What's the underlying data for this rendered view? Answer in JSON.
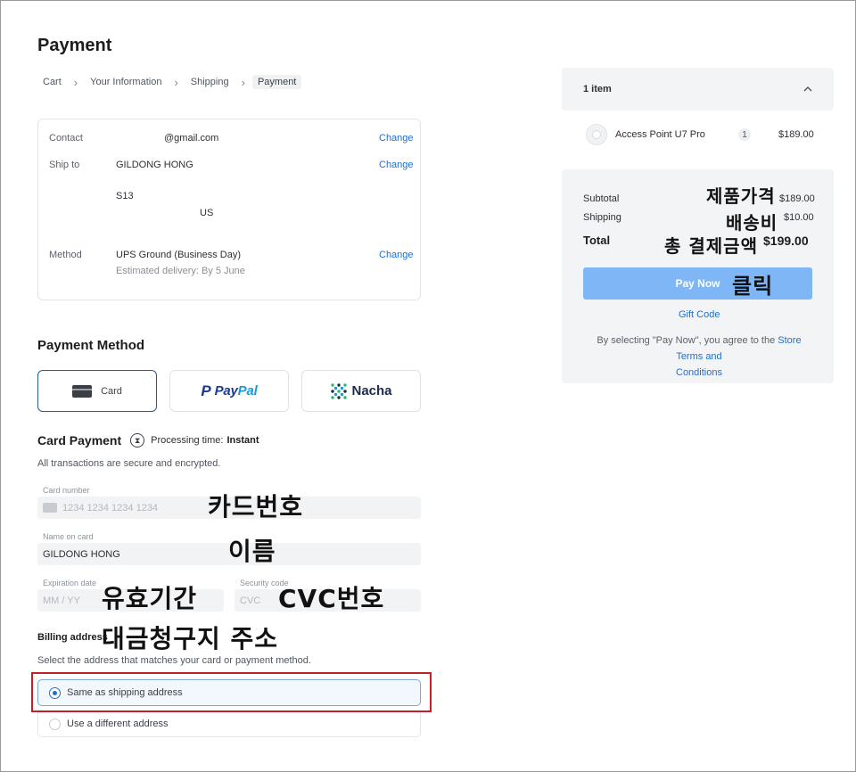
{
  "page": {
    "title": "Payment"
  },
  "breadcrumb": [
    "Cart",
    "Your Information",
    "Shipping",
    "Payment"
  ],
  "info": {
    "contact_label": "Contact",
    "contact_value": "@gmail.com",
    "ship_label": "Ship to",
    "ship_name": "GILDONG HONG",
    "ship_line1": "S13",
    "ship_country": "US",
    "method_label": "Method",
    "method_value": "UPS Ground (Business Day)",
    "method_eta": "Estimated delivery: By 5 June",
    "change_label": "Change"
  },
  "payment_method": {
    "heading": "Payment Method",
    "card_label": "Card",
    "paypal": {
      "pay": "Pay",
      "pal": "Pal",
      "icon": "paypal-p-icon"
    },
    "nacha_label": "Nacha"
  },
  "card_payment": {
    "heading": "Card Payment",
    "processing_label": "Processing time:",
    "processing_value": "Instant",
    "secure_note": "All transactions are secure and encrypted.",
    "card_number_label": "Card number",
    "card_number_placeholder": "1234 1234 1234 1234",
    "name_label": "Name on card",
    "name_value": "GILDONG HONG",
    "exp_label": "Expiration date",
    "exp_placeholder": "MM / YY",
    "cvc_label": "Security code",
    "cvc_placeholder": "CVC"
  },
  "billing": {
    "heading": "Billing address",
    "note": "Select the address that matches your card or payment method.",
    "options": [
      "Same as shipping address",
      "Use a different address"
    ],
    "selected": 0
  },
  "order": {
    "item_count": "1 item",
    "item_name": "Access Point U7 Pro",
    "item_qty": "1",
    "item_price": "$189.00"
  },
  "summary": {
    "subtotal_label": "Subtotal",
    "subtotal_value": "$189.00",
    "shipping_label": "Shipping",
    "shipping_value": "$10.00",
    "total_label": "Total",
    "total_value": "$199.00",
    "pay_button": "Pay Now",
    "gift_code": "Gift Code",
    "terms_prefix": "By selecting \"Pay Now\", you agree to the ",
    "terms_link_1": "Store Terms and",
    "terms_link_2": "Conditions"
  },
  "annotations": {
    "card_number": "카드번호",
    "name": "이름",
    "expiry": "유효기간",
    "cvc": "CVC번호",
    "billing": "대금청구지 주소",
    "product_price": "제품가격",
    "shipping_fee": "배송비",
    "total_payment": "총 결제금액",
    "click": "클릭"
  },
  "colors": {
    "accent": "#1f6fd0",
    "pay_button": "#7fb6f6",
    "highlight_outline": "#c0202a",
    "selected_tile": "#2a5b86"
  }
}
